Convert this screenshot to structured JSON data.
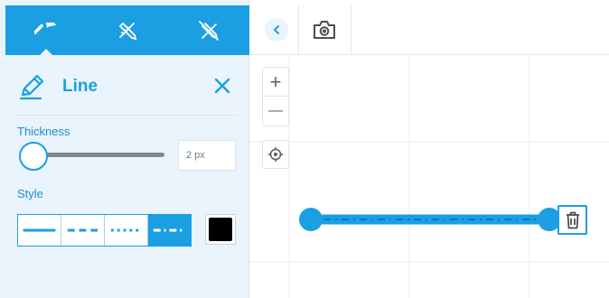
{
  "toolbar": {
    "tabs": [
      {
        "icon": "hammer-icon",
        "active": true
      },
      {
        "icon": "ruler-pencil-icon",
        "active": false
      },
      {
        "icon": "ruler-pencil-crossed-icon",
        "active": false
      }
    ],
    "accent_color": "#1a9fe3"
  },
  "panel": {
    "title": "Line",
    "title_icon": "pencil-icon",
    "close_icon": "close-icon",
    "thickness": {
      "label": "Thickness",
      "value": "2 px",
      "slider_fraction": 0
    },
    "style": {
      "label": "Style",
      "options": [
        "solid",
        "dashed",
        "dotted",
        "dash-dot"
      ],
      "selected": "dash-dot"
    },
    "color": "#000000"
  },
  "top_bar": {
    "collapse_icon": "chevron-left-icon",
    "screenshot_icon": "camera-icon"
  },
  "map_controls": {
    "zoom_in": "+",
    "zoom_out": "—",
    "locate_icon": "crosshair-icon"
  },
  "drawing": {
    "shape": "line",
    "line_style": "dash-dot",
    "line_color": "#1a9fe3",
    "delete_icon": "trash-icon"
  }
}
